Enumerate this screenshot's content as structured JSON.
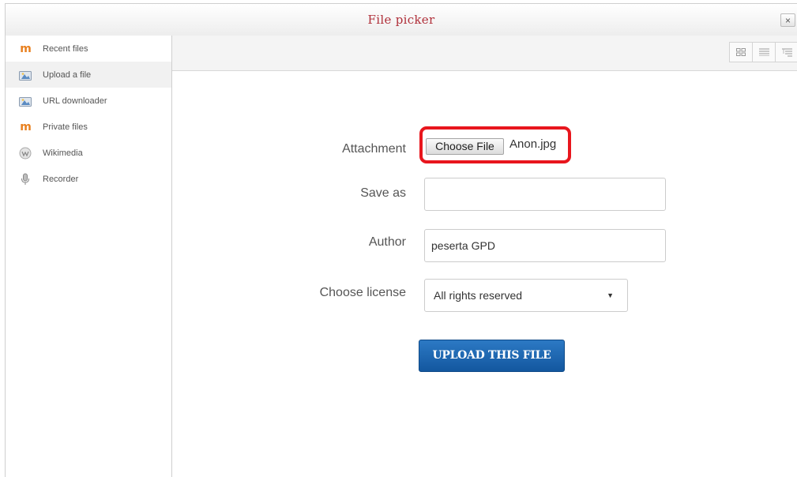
{
  "dialog": {
    "title": "File picker",
    "close_label": "×"
  },
  "sidebar": {
    "items": [
      {
        "label": "Recent files",
        "icon": "moodle-icon",
        "active": false
      },
      {
        "label": "Upload a file",
        "icon": "upload-icon",
        "active": true
      },
      {
        "label": "URL downloader",
        "icon": "url-download-icon",
        "active": false
      },
      {
        "label": "Private files",
        "icon": "moodle-icon",
        "active": false
      },
      {
        "label": "Wikimedia",
        "icon": "wikimedia-icon",
        "active": false
      },
      {
        "label": "Recorder",
        "icon": "microphone-icon",
        "active": false
      }
    ]
  },
  "toolbar": {
    "view_buttons": [
      "grid-view-icon",
      "list-view-icon",
      "tree-view-icon"
    ]
  },
  "form": {
    "attachment_label": "Attachment",
    "choose_file_label": "Choose File",
    "chosen_file": "Anon.jpg",
    "save_as_label": "Save as",
    "save_as_value": "",
    "author_label": "Author",
    "author_value": "peserta GPD",
    "license_label": "Choose license",
    "license_value": "All rights reserved",
    "upload_button": "UPLOAD THIS FILE"
  },
  "colors": {
    "title": "#b0303a",
    "highlight": "#e8161d",
    "primary_button": "#1a62ad",
    "moodle_orange": "#e8801f"
  }
}
